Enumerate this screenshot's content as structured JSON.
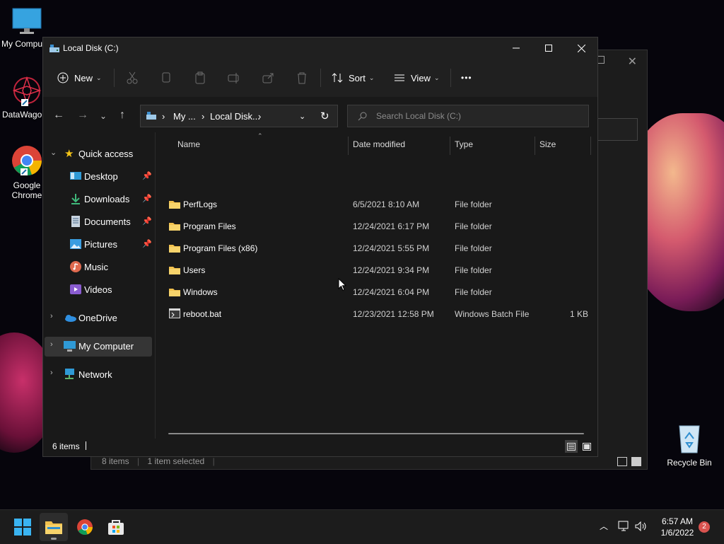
{
  "desktop": {
    "icons": [
      {
        "label": "My Compu"
      },
      {
        "label": "DataWagor"
      },
      {
        "label": "Google Chrome"
      },
      {
        "label": "Recycle Bin"
      }
    ]
  },
  "background_window": {
    "status_items": "8 items",
    "status_selected": "1 item selected"
  },
  "explorer": {
    "title": "Local Disk (C:)",
    "toolbar": {
      "new_label": "New",
      "sort_label": "Sort",
      "view_label": "View",
      "more_label": "•••"
    },
    "address": {
      "crumbs": [
        "My ...",
        "Local Disk..."
      ]
    },
    "search": {
      "placeholder": "Search Local Disk (C:)"
    },
    "sidebar": {
      "items": [
        {
          "label": "Quick access"
        },
        {
          "label": "Desktop"
        },
        {
          "label": "Downloads"
        },
        {
          "label": "Documents"
        },
        {
          "label": "Pictures"
        },
        {
          "label": "Music"
        },
        {
          "label": "Videos"
        },
        {
          "label": "OneDrive"
        },
        {
          "label": "My Computer"
        },
        {
          "label": "Network"
        }
      ]
    },
    "columns": {
      "name": "Name",
      "date": "Date modified",
      "type": "Type",
      "size": "Size"
    },
    "files": [
      {
        "name": "PerfLogs",
        "date": "6/5/2021 8:10 AM",
        "type": "File folder",
        "size": ""
      },
      {
        "name": "Program Files",
        "date": "12/24/2021 6:17 PM",
        "type": "File folder",
        "size": ""
      },
      {
        "name": "Program Files (x86)",
        "date": "12/24/2021 5:55 PM",
        "type": "File folder",
        "size": ""
      },
      {
        "name": "Users",
        "date": "12/24/2021 9:34 PM",
        "type": "File folder",
        "size": ""
      },
      {
        "name": "Windows",
        "date": "12/24/2021 6:04 PM",
        "type": "File folder",
        "size": ""
      },
      {
        "name": "reboot.bat",
        "date": "12/23/2021 12:58 PM",
        "type": "Windows Batch File",
        "size": "1 KB"
      }
    ],
    "status": {
      "count": "6 items"
    }
  },
  "taskbar": {
    "time": "6:57 AM",
    "date": "1/6/2022",
    "notification_count": "2"
  },
  "colors": {
    "folder": "#f2c14e",
    "accent": "#60cdff",
    "window_bg": "#191919"
  }
}
